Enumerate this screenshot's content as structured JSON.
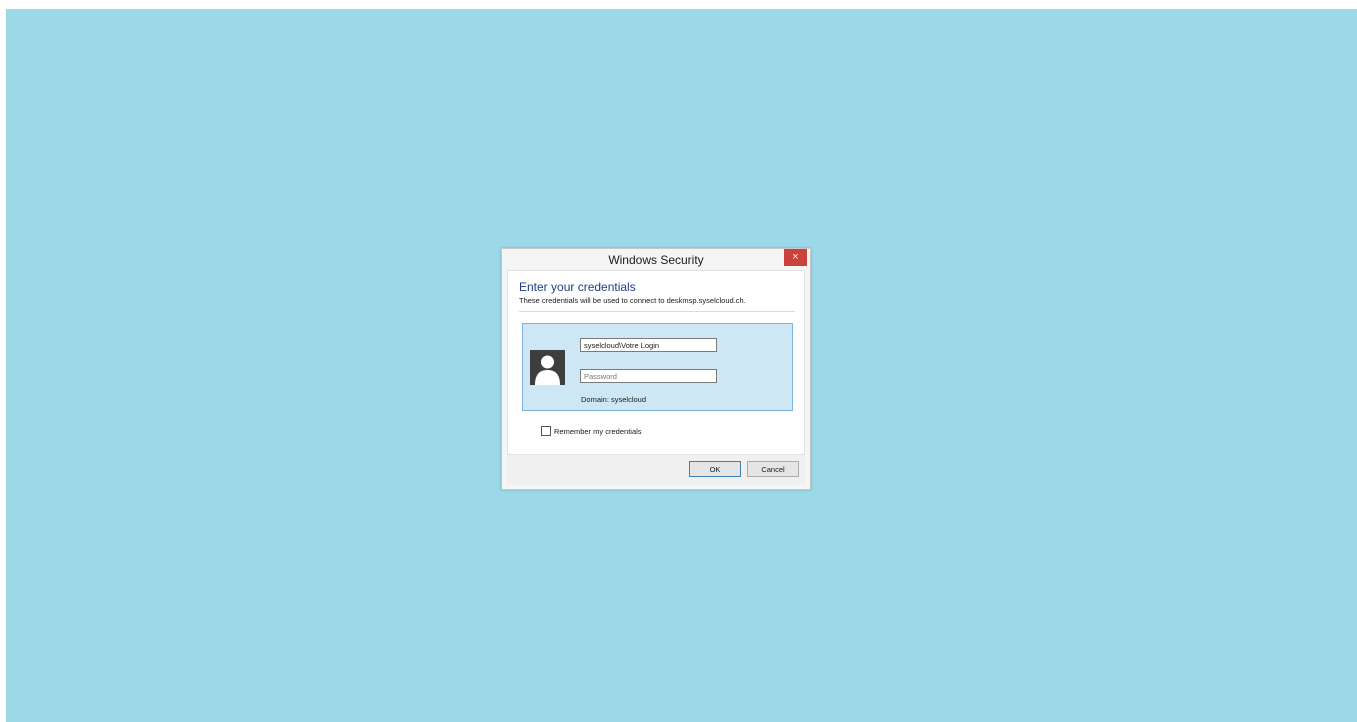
{
  "dialog": {
    "title": "Windows Security",
    "close_label": "×",
    "heading": "Enter your credentials",
    "subtext": "These credentials will be used to connect to deskmsp.syselcloud.ch.",
    "username_value": "syselcloud\\Votre Login",
    "password_placeholder": "Password",
    "domain_text": "Domain: syselcloud",
    "remember_label": "Remember my credentials",
    "remember_checked": false,
    "ok_label": "OK",
    "cancel_label": "Cancel"
  },
  "icons": {
    "avatar": "user-avatar-icon",
    "close": "close-icon"
  },
  "colors": {
    "desktop_background": "#9bd8e8",
    "heading": "#1e3f8a",
    "close_button": "#c9423b",
    "credential_tile": "#cde7f5",
    "credential_tile_border": "#7eb4dc"
  }
}
